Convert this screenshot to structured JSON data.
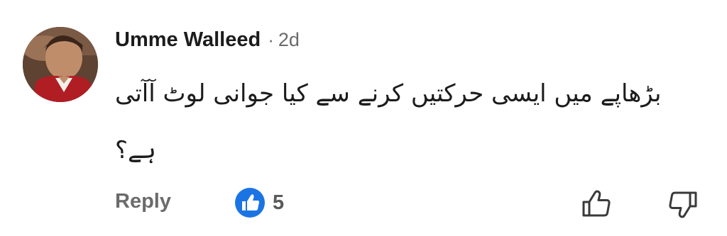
{
  "comment": {
    "author": "Umme Walleed",
    "separator": "·",
    "time": "2d",
    "text": "بڑھاپے میں ایسی حرکتیں کرنے سے کیا جوانی لوٹ آآتی ہے؟"
  },
  "actions": {
    "reply_label": "Reply",
    "like_count": "5"
  },
  "icons": {
    "avatar": "user-avatar-photo",
    "like_badge": "blue-thumbs-up-badge",
    "like_button": "thumbs-up-outline",
    "dislike_button": "thumbs-down-outline"
  },
  "colors": {
    "like_badge_blue": "#1b74e4",
    "muted_text": "#6b6b6b",
    "primary_text": "#1c1c1c"
  }
}
